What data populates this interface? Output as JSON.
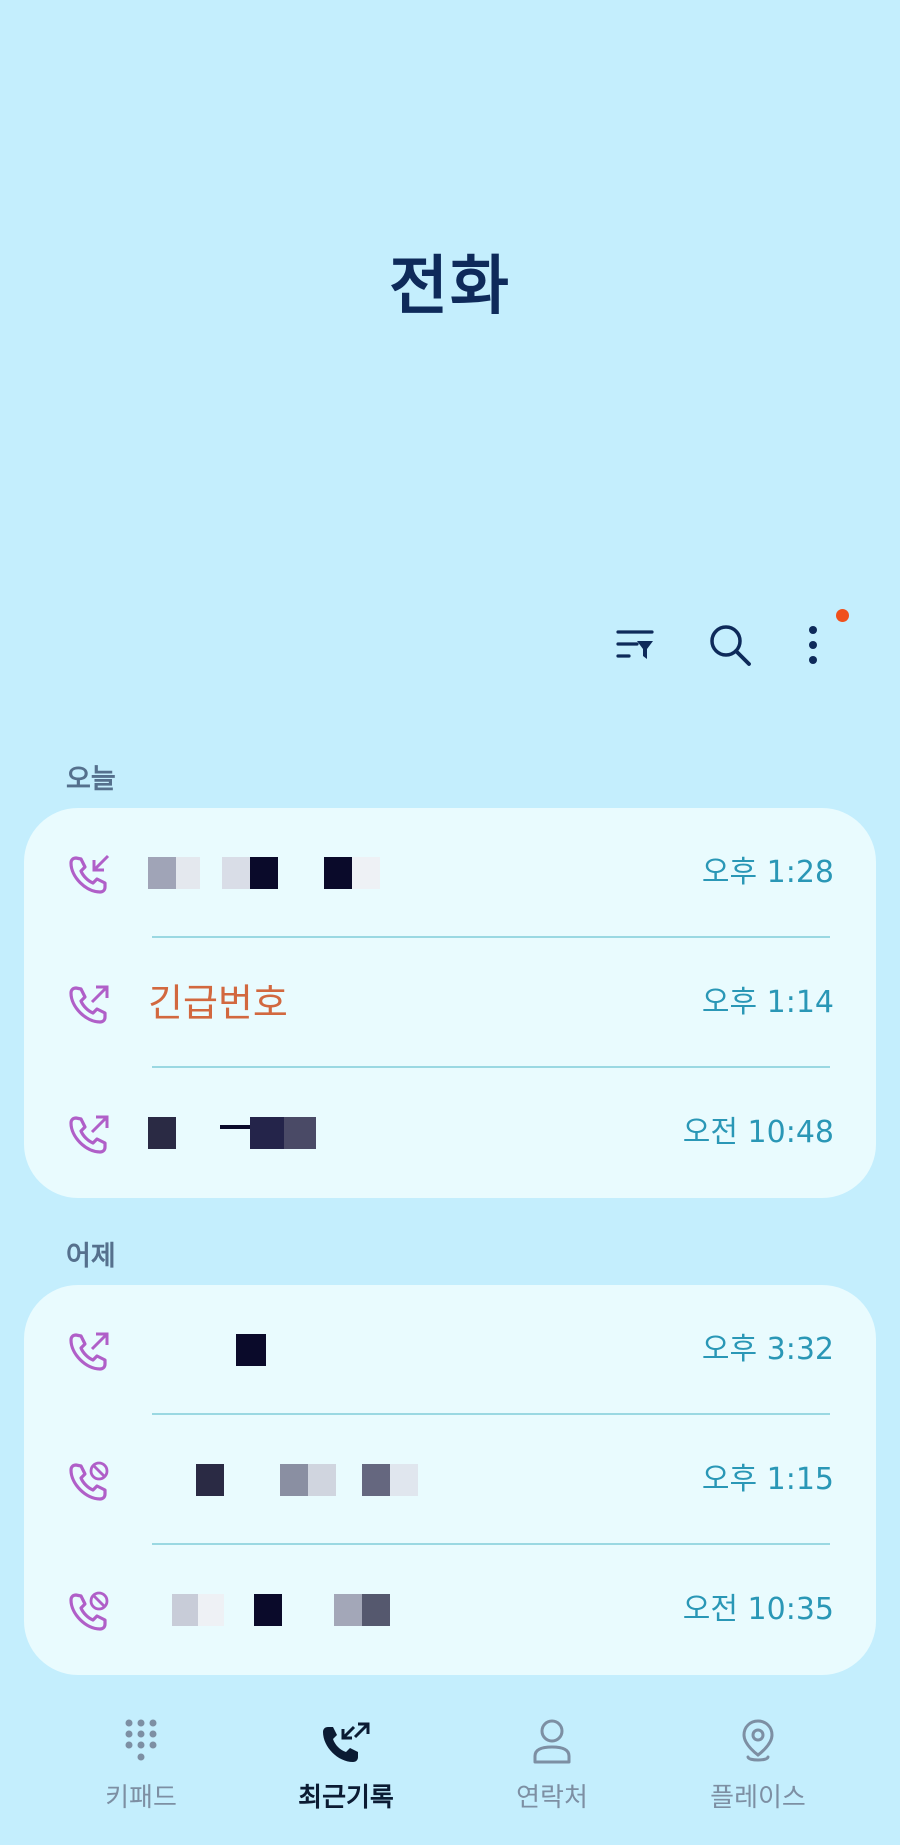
{
  "header": {
    "title": "전화"
  },
  "toolbar": {
    "filter_icon": "filter-list-icon",
    "search_icon": "search-icon",
    "more_icon": "more-vertical-icon",
    "notification_dot_color": "#f0501c"
  },
  "sections": [
    {
      "label": "오늘",
      "calls": [
        {
          "type": "incoming",
          "icon": "incoming-call-icon",
          "name": "",
          "time": "오후 1:28"
        },
        {
          "type": "outgoing",
          "icon": "outgoing-call-icon",
          "name": "긴급번호",
          "time": "오후 1:14"
        },
        {
          "type": "outgoing",
          "icon": "outgoing-call-icon",
          "name": "",
          "time": "오전 10:48"
        }
      ]
    },
    {
      "label": "어제",
      "calls": [
        {
          "type": "outgoing",
          "icon": "outgoing-call-icon",
          "name": "",
          "time": "오후 3:32"
        },
        {
          "type": "rejected",
          "icon": "rejected-call-icon",
          "name": "",
          "time": "오후 1:15"
        },
        {
          "type": "rejected",
          "icon": "rejected-call-icon",
          "name": "",
          "time": "오전 10:35"
        }
      ]
    }
  ],
  "bottom_nav": [
    {
      "label": "키패드",
      "icon": "keypad-icon",
      "active": false
    },
    {
      "label": "최근기록",
      "icon": "recent-calls-icon",
      "active": true
    },
    {
      "label": "연락처",
      "icon": "contact-person-icon",
      "active": false
    },
    {
      "label": "플레이스",
      "icon": "location-pin-icon",
      "active": false
    }
  ],
  "colors": {
    "background": "#c4eefd",
    "card": "#e9fbfe",
    "time_text": "#2a97b6",
    "emergency_text": "#d2683f",
    "call_icon": "#b05fc8"
  }
}
